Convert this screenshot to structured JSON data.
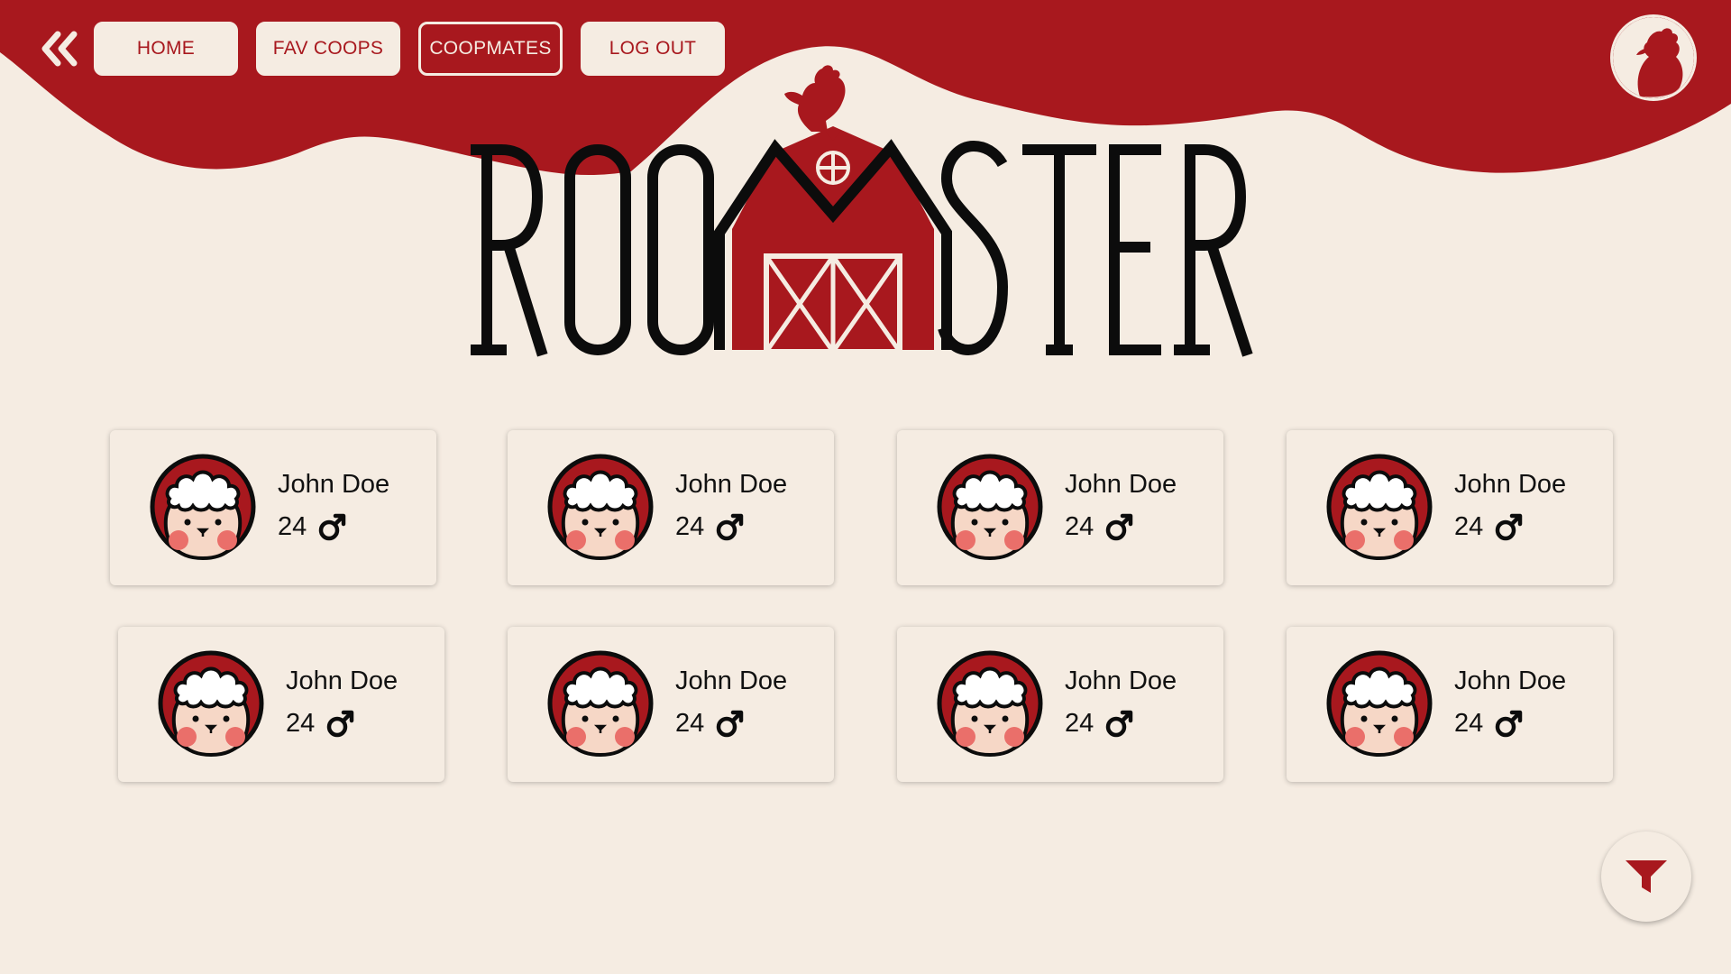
{
  "colors": {
    "accent": "#a8181e",
    "background": "#f5ece2",
    "text": "#111111"
  },
  "nav": {
    "back_icon": "double-chevron-left-icon",
    "items": [
      {
        "label": "HOME",
        "active": false
      },
      {
        "label": "FAV COOPS",
        "active": false
      },
      {
        "label": "COOPMATES",
        "active": true
      },
      {
        "label": "LOG OUT",
        "active": false
      }
    ],
    "profile_icon": "rooster-avatar-icon"
  },
  "logo": {
    "text_left": "ROO",
    "text_right": "STER",
    "icon": "barn-rooster-icon"
  },
  "coopmates": [
    {
      "name": "John Doe",
      "age": "24",
      "gender_icon": "male-symbol-icon"
    },
    {
      "name": "John Doe",
      "age": "24",
      "gender_icon": "male-symbol-icon"
    },
    {
      "name": "John Doe",
      "age": "24",
      "gender_icon": "male-symbol-icon"
    },
    {
      "name": "John Doe",
      "age": "24",
      "gender_icon": "male-symbol-icon"
    },
    {
      "name": "John Doe",
      "age": "24",
      "gender_icon": "male-symbol-icon"
    },
    {
      "name": "John Doe",
      "age": "24",
      "gender_icon": "male-symbol-icon"
    },
    {
      "name": "John Doe",
      "age": "24",
      "gender_icon": "male-symbol-icon"
    },
    {
      "name": "John Doe",
      "age": "24",
      "gender_icon": "male-symbol-icon"
    }
  ],
  "filter_icon": "funnel-icon"
}
